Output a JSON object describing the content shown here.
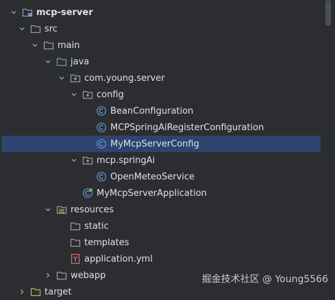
{
  "colors": {
    "background": "#2b2d30",
    "selection": "#2e436e",
    "text": "#dfe1e5",
    "folder": "#9aa0a8",
    "source_folder": "#6b9bd2",
    "class_icon": "#5e9cd6",
    "yml_icon": "#e06c6c"
  },
  "tree": [
    {
      "label": "mcp-server",
      "bold": true,
      "chevron": "down",
      "icon": "module-folder-icon"
    },
    {
      "label": "src",
      "chevron": "down",
      "icon": "folder-icon"
    },
    {
      "label": "main",
      "chevron": "down",
      "icon": "folder-icon"
    },
    {
      "label": "java",
      "chevron": "down",
      "icon": "source-folder-icon"
    },
    {
      "label": "com.young.server",
      "chevron": "down",
      "icon": "package-icon"
    },
    {
      "label": "config",
      "chevron": "down",
      "icon": "package-icon"
    },
    {
      "label": "BeanConfiguration",
      "chevron": "",
      "icon": "class-icon"
    },
    {
      "label": "MCPSpringAiRegisterConfiguration",
      "chevron": "",
      "icon": "class-icon"
    },
    {
      "label": "MyMcpServerConfig",
      "chevron": "",
      "icon": "class-icon",
      "selected": true
    },
    {
      "label": "mcp.springAi",
      "chevron": "down",
      "icon": "package-icon"
    },
    {
      "label": "OpenMeteoService",
      "chevron": "",
      "icon": "class-icon"
    },
    {
      "label": "MyMcpServerApplication",
      "chevron": "",
      "icon": "spring-class-icon"
    },
    {
      "label": "resources",
      "chevron": "down",
      "icon": "resources-folder-icon"
    },
    {
      "label": "static",
      "chevron": "",
      "icon": "folder-icon"
    },
    {
      "label": "templates",
      "chevron": "",
      "icon": "folder-icon"
    },
    {
      "label": "application.yml",
      "chevron": "",
      "icon": "yml-file-icon"
    },
    {
      "label": "webapp",
      "chevron": "right",
      "icon": "folder-icon"
    },
    {
      "label": "target",
      "chevron": "right",
      "icon": "folder-icon"
    }
  ],
  "watermark": "掘金技术社区 @ Young5566"
}
